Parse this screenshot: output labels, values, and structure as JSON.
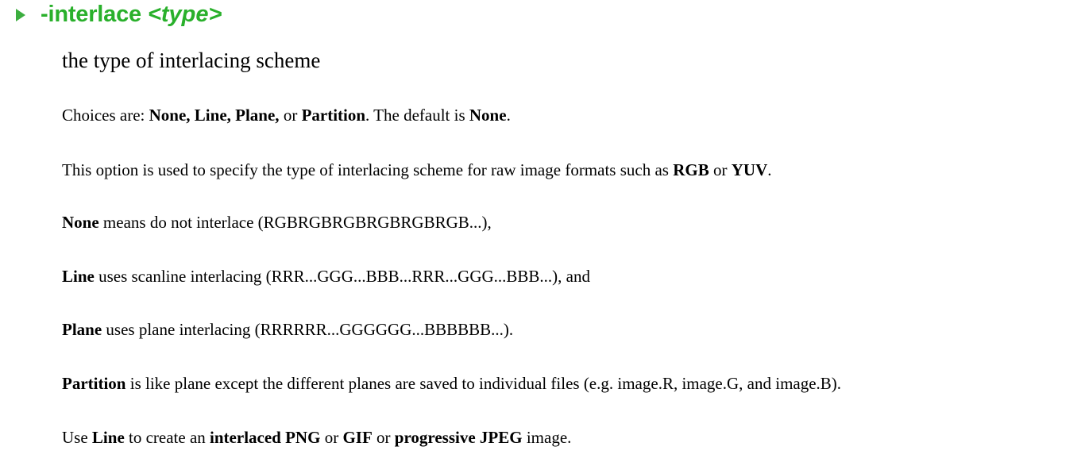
{
  "option": {
    "name": "-interlace",
    "argument": "<type>",
    "summary": "the type of interlacing scheme"
  },
  "paragraphs": {
    "choices": {
      "lead": "Choices are: ",
      "c1": "None, ",
      "c2": "Line, ",
      "c3": "Plane, ",
      "or": "or ",
      "c4": "Partition",
      "mid": ". The default is ",
      "default": "None",
      "end": "."
    },
    "purpose": {
      "text": "This option is used to specify the type of interlacing scheme for raw image formats such as ",
      "f1": "RGB",
      "or": " or ",
      "f2": "YUV",
      "end": "."
    },
    "none": {
      "term": "None",
      "text": " means do not interlace (RGBRGBRGBRGBRGBRGB...),"
    },
    "line": {
      "term": "Line",
      "text": " uses scanline interlacing (RRR...GGG...BBB...RRR...GGG...BBB...), and"
    },
    "plane": {
      "term": "Plane",
      "text": " uses plane interlacing (RRRRRR...GGGGGG...BBBBBB...)."
    },
    "partition": {
      "term": "Partition",
      "text": " is like plane except the different planes are saved to individual files (e.g. image.R, image.G, and image.B)."
    },
    "usage": {
      "lead": "Use ",
      "term": "Line",
      "mid1": " to create an ",
      "b1": "interlaced PNG",
      "or1": " or ",
      "b2": "GIF",
      "or2": " or ",
      "b3": "progressive JPEG",
      "end": " image."
    }
  }
}
